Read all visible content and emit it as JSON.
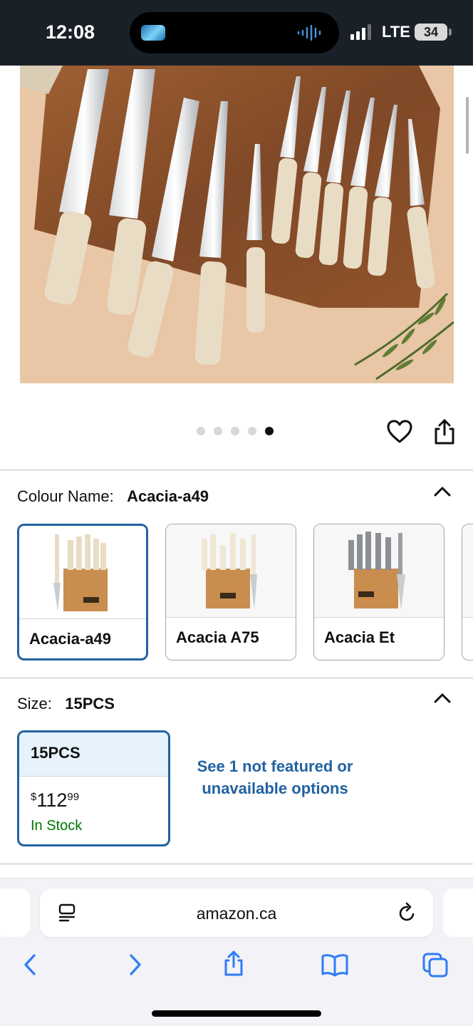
{
  "status_bar": {
    "time": "12:08",
    "network": "LTE",
    "battery": "34"
  },
  "product_image": {
    "dots_total": 5,
    "active_dot": 4,
    "icons": [
      "heart-icon",
      "share-icon"
    ]
  },
  "colour_section": {
    "label": "Colour Name:",
    "value": "Acacia-a49",
    "options": [
      {
        "label": "Acacia-a49",
        "selected": true
      },
      {
        "label": "Acacia A75",
        "selected": false
      },
      {
        "label": "Acacia Et",
        "selected": false
      }
    ]
  },
  "size_section": {
    "label": "Size:",
    "value": "15PCS",
    "card": {
      "title": "15PCS",
      "currency": "$",
      "price_whole": "112",
      "price_fraction": "99",
      "stock": "In Stock"
    },
    "more_options": "See 1 not featured or unavailable options"
  },
  "browser": {
    "url": "amazon.ca"
  },
  "colors": {
    "selected_border": "#2162a1",
    "link": "#2162a1",
    "in_stock": "#007600",
    "status_bar_bg": "#1a2028"
  }
}
